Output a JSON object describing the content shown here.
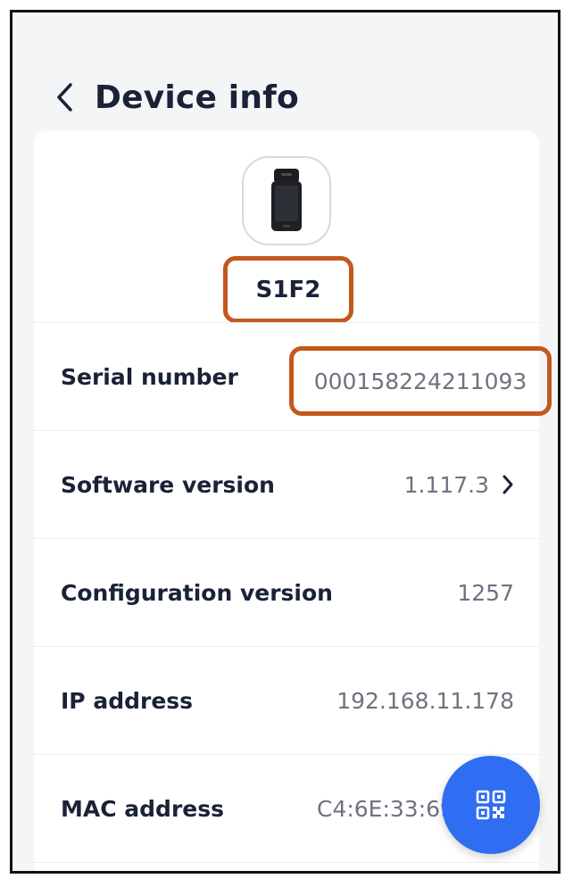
{
  "header": {
    "title": "Device info",
    "back_icon": "chevron-left-icon"
  },
  "device": {
    "name": "S1F2",
    "image_icon": "payment-terminal-image"
  },
  "rows": [
    {
      "label": "Serial number",
      "value": "000158224211093"
    },
    {
      "label": "Software version",
      "value": "1.117.3",
      "icon": "chevron-right-icon"
    },
    {
      "label": "Configuration version",
      "value": "1257"
    },
    {
      "label": "IP address",
      "value": "192.168.11.178"
    },
    {
      "label": "MAC address",
      "value": "C4:6E:33:69"
    }
  ],
  "fab": {
    "icon": "qr-code-icon"
  },
  "colors": {
    "accent": "#2f6df2",
    "highlight": "#c4581c",
    "text_primary": "#1a2238",
    "text_secondary": "#6e7380"
  }
}
